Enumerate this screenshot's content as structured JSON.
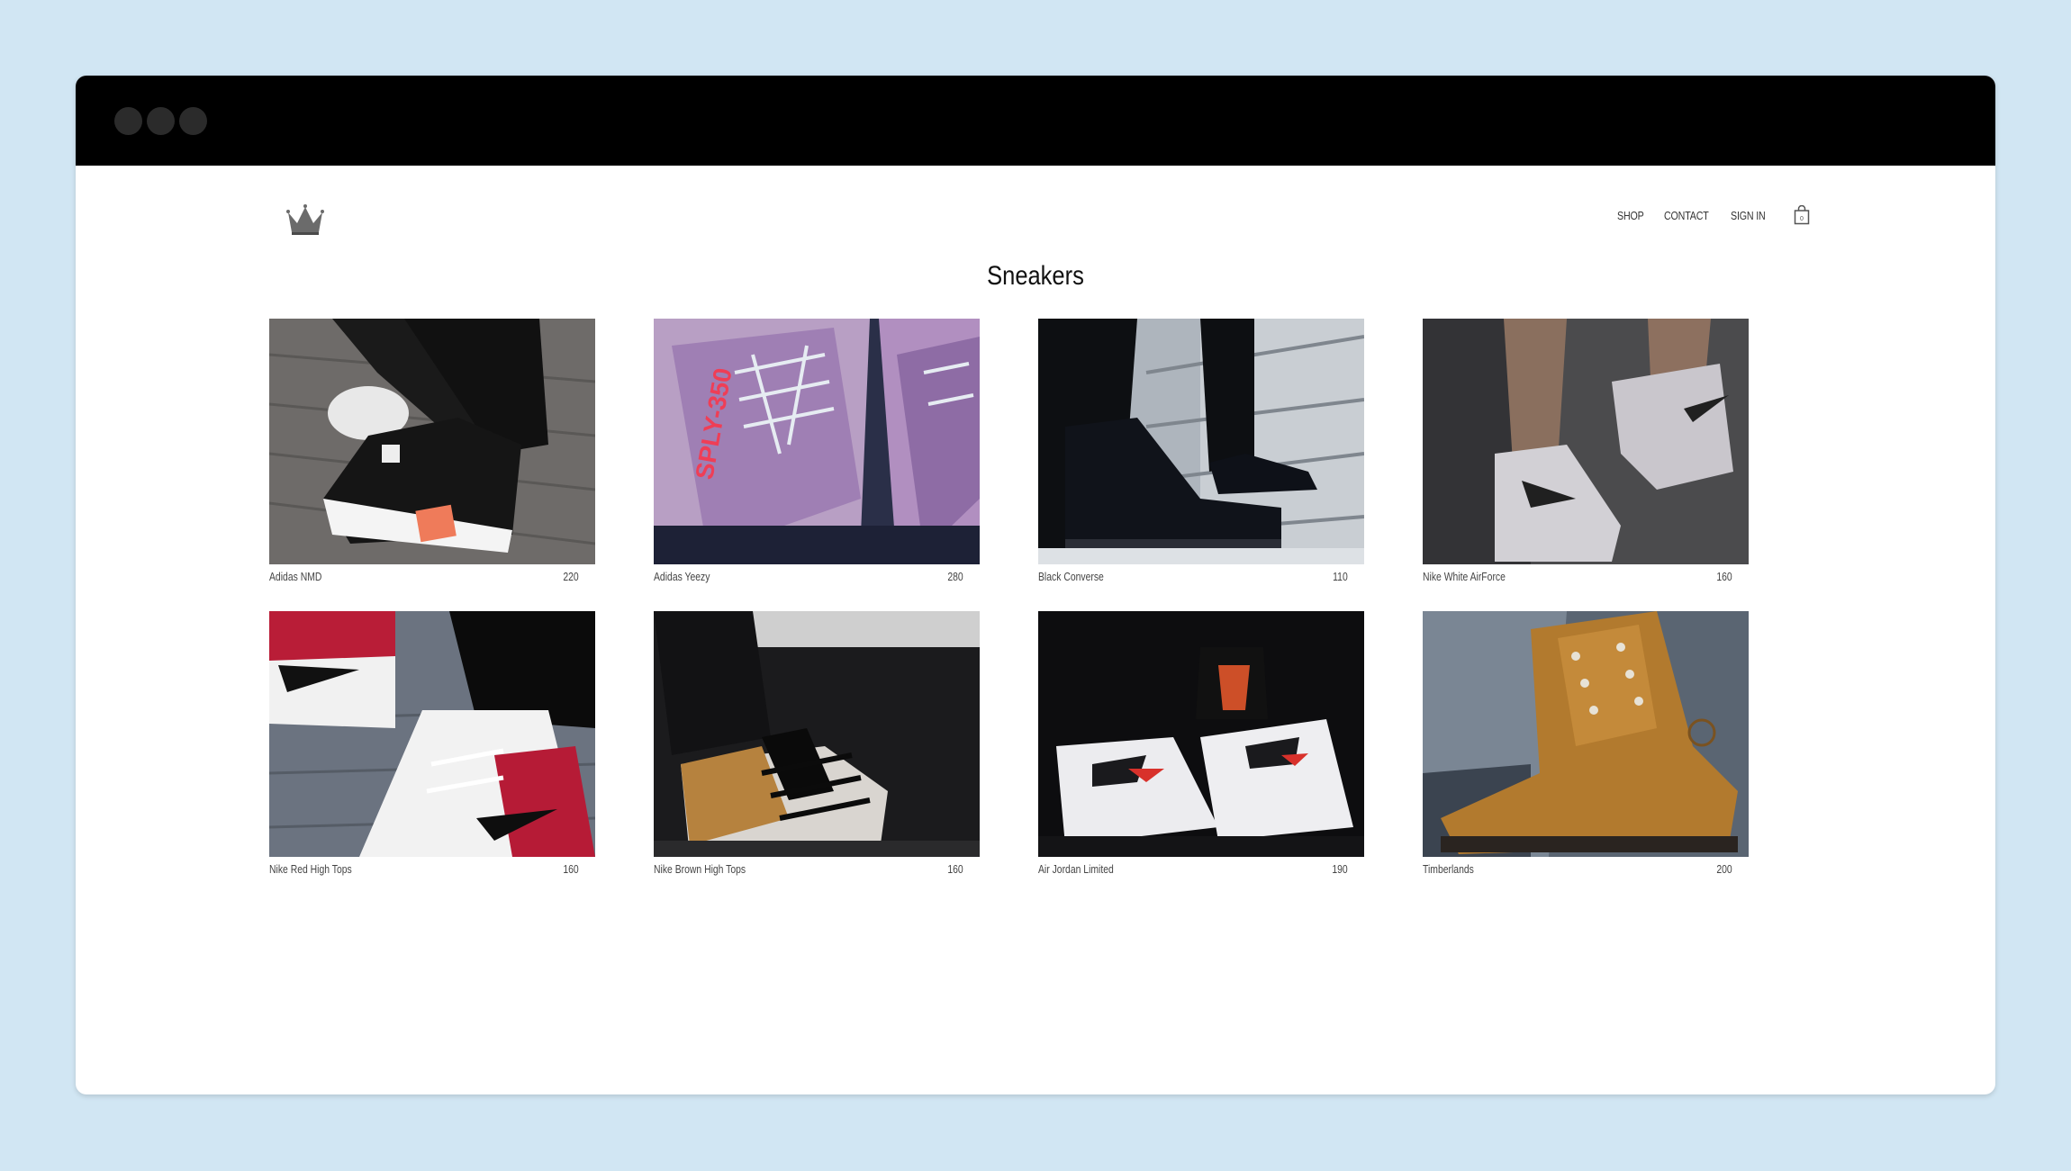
{
  "nav": {
    "shop": "SHOP",
    "contact": "CONTACT",
    "sign_in": "SIGN IN"
  },
  "page": {
    "title": "Sneakers"
  },
  "products": [
    {
      "name": "Adidas NMD",
      "price": "220"
    },
    {
      "name": "Adidas Yeezy",
      "price": "280"
    },
    {
      "name": "Black Converse",
      "price": "110"
    },
    {
      "name": "Nike White AirForce",
      "price": "160"
    },
    {
      "name": "Nike Red High Tops",
      "price": "160"
    },
    {
      "name": "Nike Brown High Tops",
      "price": "160"
    },
    {
      "name": "Air Jordan Limited",
      "price": "190"
    },
    {
      "name": "Timberlands",
      "price": "200"
    }
  ],
  "icons": {
    "logo": "crown-icon",
    "cart": "shopping-bag-icon"
  },
  "colors": {
    "background": "#d1e6f3",
    "titlebar": "#000000",
    "window": "#ffffff"
  }
}
